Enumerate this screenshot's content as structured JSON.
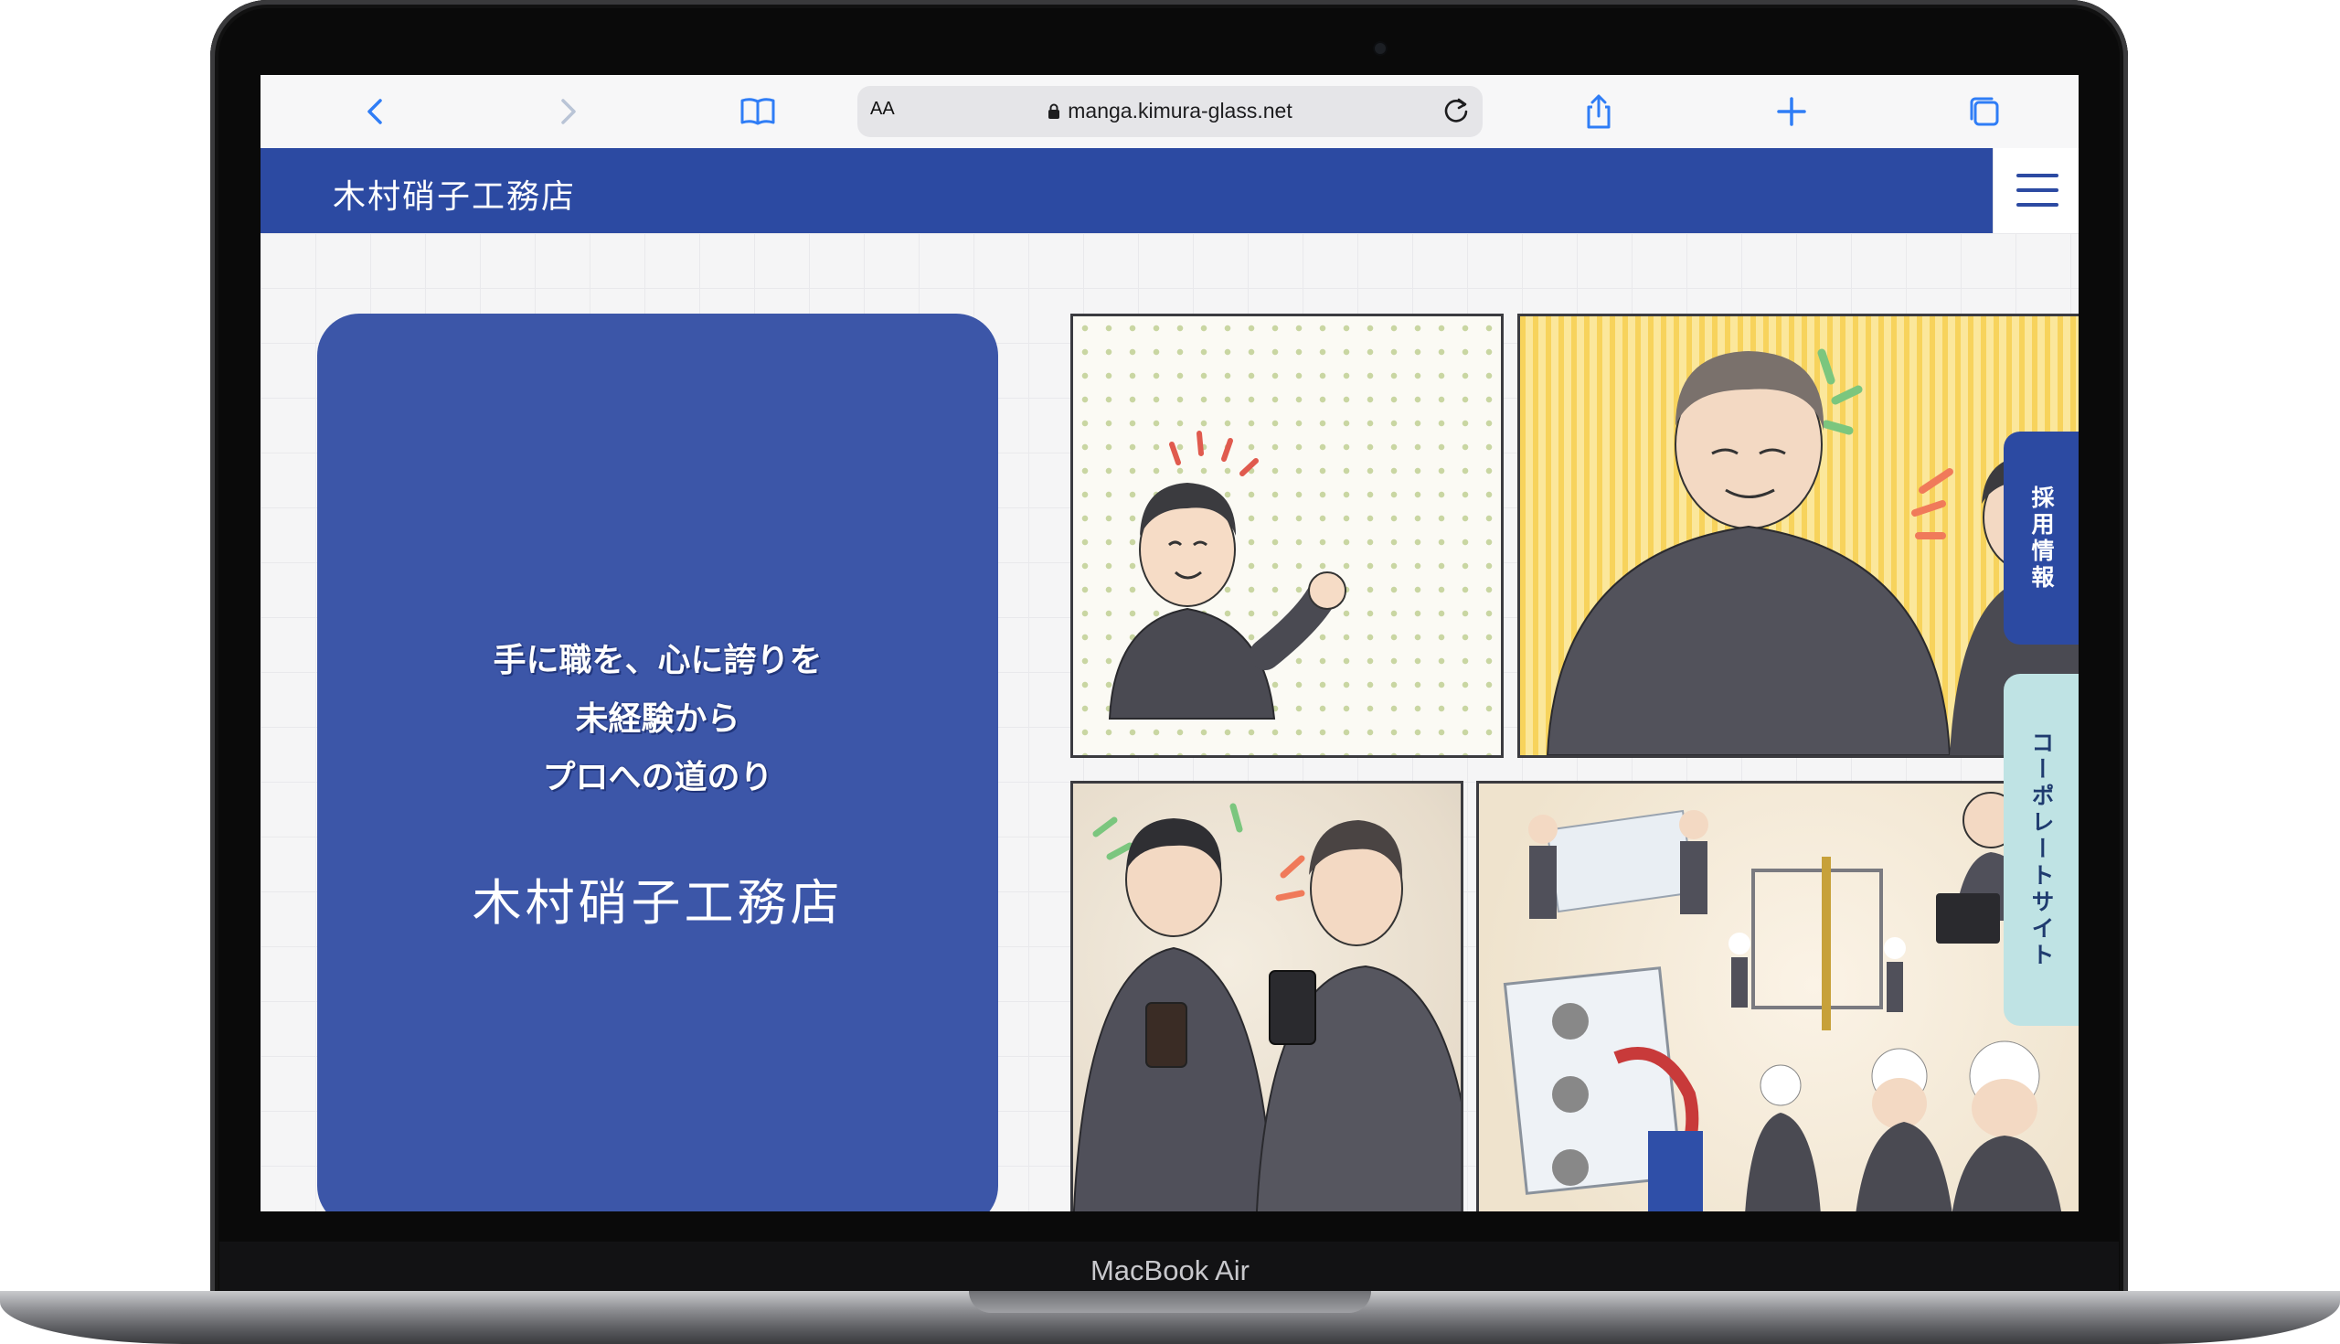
{
  "device": {
    "model_label": "MacBook Air"
  },
  "browser": {
    "text_size_label": "AA",
    "url": "manga.kimura-glass.net",
    "icons": [
      "back-icon",
      "forward-icon",
      "bookmarks-icon",
      "lock-icon",
      "reload-icon",
      "share-icon",
      "new-tab-icon",
      "tabs-icon"
    ]
  },
  "site": {
    "logo": "木村硝子工務店",
    "hero": {
      "tagline_1": "手に職を、心に誇りを",
      "tagline_2": "未経験から",
      "tagline_3": "プロへの道のり",
      "company_name": "木村硝子工務店"
    },
    "side_tabs": {
      "recruit": "採用情報",
      "corporate": "コーポレートサイト"
    }
  },
  "colors": {
    "brand_blue": "#2c4aa2",
    "hero_blue": "#3c56a8",
    "tab_mint": "#bfe3e4",
    "safari_accent": "#2f7df6"
  }
}
